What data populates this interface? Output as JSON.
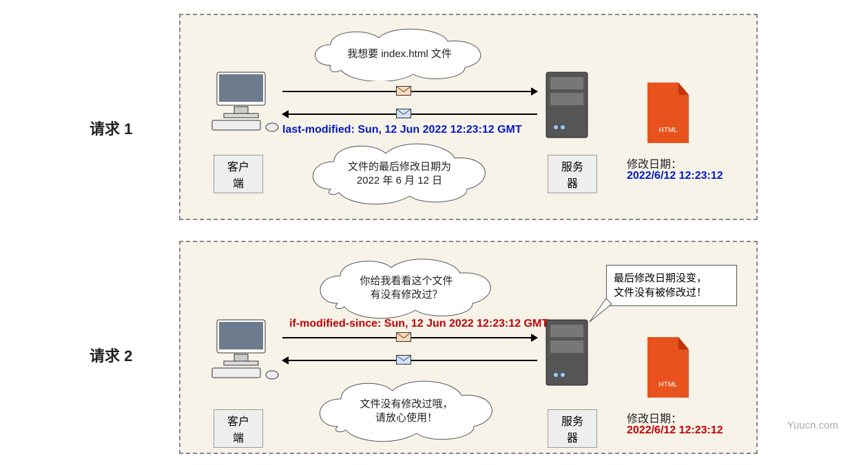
{
  "watermark": "Yuucn.com",
  "request1": {
    "side_label": "请求 1",
    "client_label": "客户端",
    "server_label": "服务器",
    "top_bubble": "我想要 index.html 文件",
    "header_line": "last-modified: Sun, 12 Jun 2022 12:23:12 GMT",
    "bottom_bubble": "文件的最后修改日期为\n2022 年 6 月 12 日",
    "file_tag": "HTML",
    "mod_label": "修改日期：",
    "mod_value": "2022/6/12 12:23:12"
  },
  "request2": {
    "side_label": "请求 2",
    "client_label": "客户端",
    "server_label": "服务器",
    "top_bubble": "你给我看看这个文件\n有没有修改过？",
    "header_line": "if-modified-since: Sun, 12 Jun 2022 12:23:12 GMT",
    "bottom_bubble": "文件没有修改过哦，\n请放心使用！",
    "server_speech": "最后修改日期没变，\n文件没有被修改过！",
    "file_tag": "HTML",
    "mod_label": "修改日期：",
    "mod_value": "2022/6/12 12:23:12"
  }
}
